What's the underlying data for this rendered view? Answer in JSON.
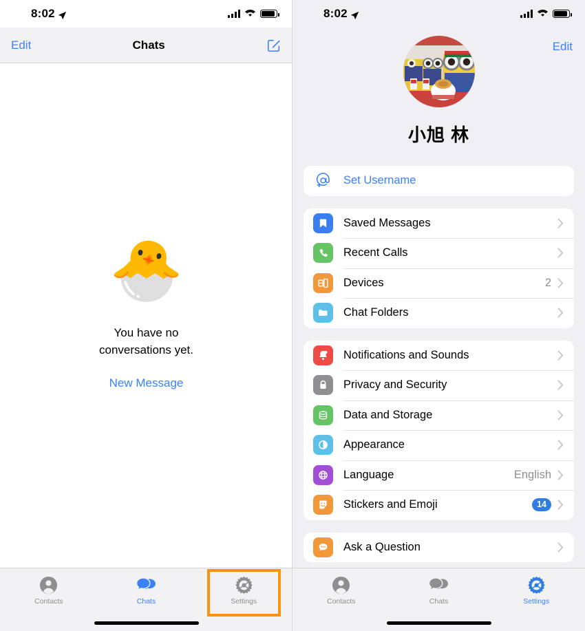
{
  "left_screen": {
    "status_bar": {
      "time": "8:02",
      "location_icon": "location-arrow-icon",
      "signal_icon": "cellular-bars-icon",
      "wifi_icon": "wifi-icon",
      "battery_icon": "battery-full-icon"
    },
    "nav": {
      "edit_label": "Edit",
      "title": "Chats",
      "compose_icon": "compose-icon"
    },
    "empty_state": {
      "emoji": "🐣",
      "line1": "You have no",
      "line2": "conversations yet.",
      "action_label": "New Message"
    },
    "tabs": [
      {
        "label": "Contacts",
        "icon": "contacts-person-icon",
        "active": false
      },
      {
        "label": "Chats",
        "icon": "chats-bubbles-icon",
        "active": true
      },
      {
        "label": "Settings",
        "icon": "settings-gear-icon",
        "active": false
      }
    ]
  },
  "right_screen": {
    "status_bar": {
      "time": "8:02",
      "location_icon": "location-arrow-icon",
      "signal_icon": "cellular-bars-icon",
      "wifi_icon": "wifi-icon",
      "battery_icon": "battery-full-icon"
    },
    "edit_label": "Edit",
    "profile": {
      "name": "小旭 林",
      "avatar_alt": "minion-figures-photo"
    },
    "groups": [
      {
        "rows": [
          {
            "label": "Set Username",
            "icon": "at-username-icon",
            "icon_bg": "#ffffff",
            "style": "link",
            "value": "",
            "badge": "",
            "chevron": false
          }
        ]
      },
      {
        "rows": [
          {
            "label": "Saved Messages",
            "icon": "bookmark-icon",
            "icon_bg": "#3b7ef0",
            "style": "normal",
            "value": "",
            "badge": "",
            "chevron": true
          },
          {
            "label": "Recent Calls",
            "icon": "phone-icon",
            "icon_bg": "#64c466",
            "style": "normal",
            "value": "",
            "badge": "",
            "chevron": true
          },
          {
            "label": "Devices",
            "icon": "devices-icon",
            "icon_bg": "#f0983a",
            "style": "normal",
            "value": "2",
            "badge": "",
            "chevron": true
          },
          {
            "label": "Chat Folders",
            "icon": "folder-icon",
            "icon_bg": "#5ec0e8",
            "style": "normal",
            "value": "",
            "badge": "",
            "chevron": true
          }
        ]
      },
      {
        "rows": [
          {
            "label": "Notifications and Sounds",
            "icon": "bell-icon",
            "icon_bg": "#ef4b46",
            "style": "normal",
            "value": "",
            "badge": "",
            "chevron": true
          },
          {
            "label": "Privacy and Security",
            "icon": "lock-icon",
            "icon_bg": "#8e8e93",
            "style": "normal",
            "value": "",
            "badge": "",
            "chevron": true
          },
          {
            "label": "Data and Storage",
            "icon": "database-icon",
            "icon_bg": "#64c466",
            "style": "normal",
            "value": "",
            "badge": "",
            "chevron": true
          },
          {
            "label": "Appearance",
            "icon": "contrast-icon",
            "icon_bg": "#5ec0e8",
            "style": "normal",
            "value": "",
            "badge": "",
            "chevron": true
          },
          {
            "label": "Language",
            "icon": "globe-icon",
            "icon_bg": "#a24fd6",
            "style": "normal",
            "value": "English",
            "badge": "",
            "chevron": true
          },
          {
            "label": "Stickers and Emoji",
            "icon": "sticker-smiley-icon",
            "icon_bg": "#f0983a",
            "style": "normal",
            "value": "",
            "badge": "14",
            "chevron": true
          }
        ]
      },
      {
        "rows": [
          {
            "label": "Ask a Question",
            "icon": "question-bubble-icon",
            "icon_bg": "#f0983a",
            "style": "normal",
            "value": "",
            "badge": "",
            "chevron": true
          }
        ]
      }
    ],
    "tabs": [
      {
        "label": "Contacts",
        "icon": "contacts-person-icon",
        "active": false
      },
      {
        "label": "Chats",
        "icon": "chats-bubbles-icon",
        "active": false
      },
      {
        "label": "Settings",
        "icon": "settings-gear-icon",
        "active": true
      }
    ]
  },
  "annotations": {
    "highlight_color": "#f59412",
    "boxes": [
      {
        "name": "settings-tab-highlight",
        "target": "Settings"
      },
      {
        "name": "privacy-and-security-highlight",
        "target": "Privacy and Security"
      }
    ]
  }
}
